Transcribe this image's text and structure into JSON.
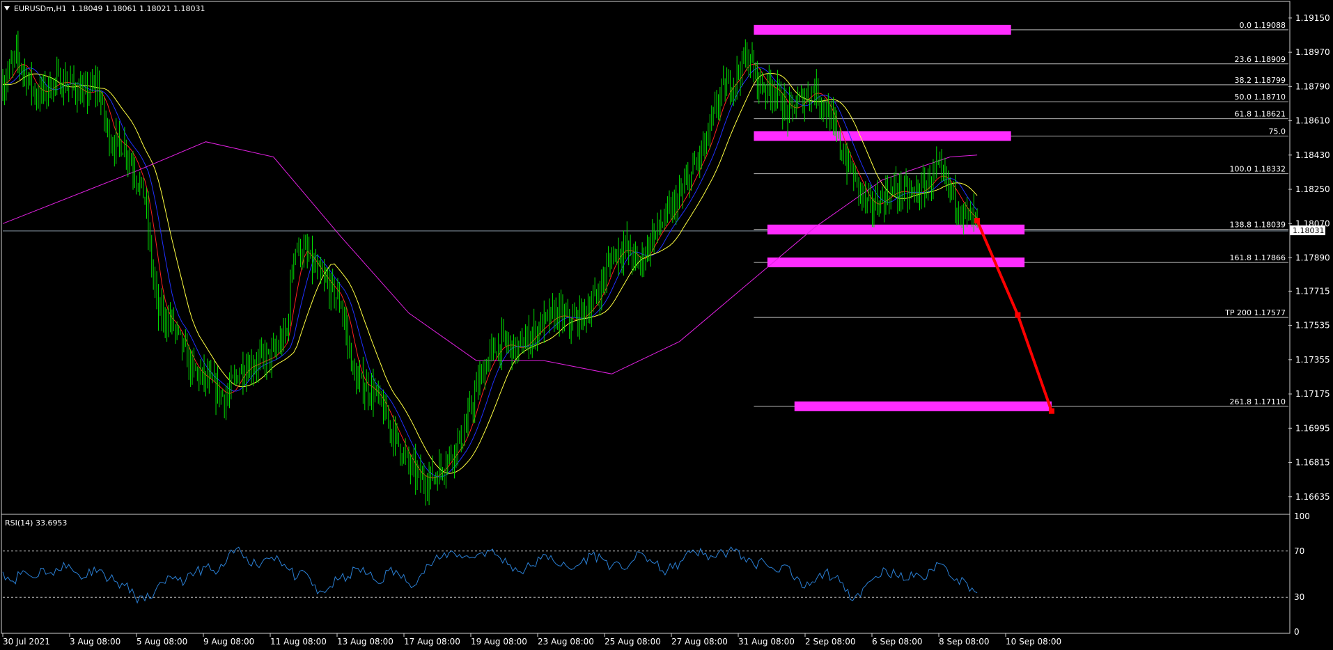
{
  "header": {
    "symbol": "EURUSDm,H1",
    "ohlc": "1.18049 1.18061 1.18021 1.18031"
  },
  "current_price_label": "1.18031",
  "rsi_header": "RSI(14) 33.6953",
  "colors": {
    "background": "#000000",
    "candle": "#00e000",
    "ma_fast_red": "#ff2020",
    "ma_blue": "#2030ff",
    "ma_yellow": "#ffff40",
    "ma_slow_magenta": "#e020e0",
    "zone": "#ff2cff",
    "arrow": "#ff0000",
    "rsi_line": "#2a7fd4"
  },
  "chart_data": [
    {
      "type": "line",
      "subtype": "candlestick price chart with fibonacci levels",
      "title": "EURUSDm,H1",
      "price_axis_ticks": [
        "1.19150",
        "1.18970",
        "1.18790",
        "1.18610",
        "1.18430",
        "1.18250",
        "1.18070",
        "1.17890",
        "1.17715",
        "1.17535",
        "1.17355",
        "1.17175",
        "1.16995",
        "1.16815",
        "1.16635"
      ],
      "ylim": [
        1.1655,
        1.1923
      ],
      "x_ticks": [
        "30 Jul 2021",
        "3 Aug 08:00",
        "5 Aug 08:00",
        "9 Aug 08:00",
        "11 Aug 08:00",
        "13 Aug 08:00",
        "17 Aug 08:00",
        "19 Aug 08:00",
        "23 Aug 08:00",
        "25 Aug 08:00",
        "27 Aug 08:00",
        "31 Aug 08:00",
        "2 Sep 08:00",
        "6 Sep 08:00",
        "8 Sep 08:00",
        "10 Sep 08:00"
      ],
      "price_path": [
        [
          0,
          1.188
        ],
        [
          2,
          1.1895
        ],
        [
          5,
          1.1874
        ],
        [
          8,
          1.1882
        ],
        [
          10,
          1.188
        ],
        [
          12,
          1.1874
        ],
        [
          14,
          1.188
        ],
        [
          15,
          1.1862
        ],
        [
          16,
          1.185
        ],
        [
          18,
          1.1848
        ],
        [
          20,
          1.183
        ],
        [
          21,
          1.182
        ],
        [
          22,
          1.1785
        ],
        [
          23,
          1.176
        ],
        [
          25,
          1.1755
        ],
        [
          28,
          1.173
        ],
        [
          30,
          1.1725
        ],
        [
          33,
          1.1715
        ],
        [
          35,
          1.173
        ],
        [
          38,
          1.1735
        ],
        [
          40,
          1.1738
        ],
        [
          42,
          1.175
        ],
        [
          43,
          1.1795
        ],
        [
          45,
          1.179
        ],
        [
          47,
          1.1778
        ],
        [
          48,
          1.1775
        ],
        [
          50,
          1.1765
        ],
        [
          52,
          1.1725
        ],
        [
          55,
          1.1718
        ],
        [
          58,
          1.1695
        ],
        [
          60,
          1.168
        ],
        [
          62,
          1.1672
        ],
        [
          64,
          1.1675
        ],
        [
          66,
          1.1685
        ],
        [
          68,
          1.1695
        ],
        [
          70,
          1.172
        ],
        [
          72,
          1.1738
        ],
        [
          74,
          1.1745
        ],
        [
          76,
          1.174
        ],
        [
          78,
          1.1748
        ],
        [
          80,
          1.1755
        ],
        [
          82,
          1.176
        ],
        [
          84,
          1.1755
        ],
        [
          86,
          1.176
        ],
        [
          88,
          1.177
        ],
        [
          89,
          1.178
        ],
        [
          90,
          1.179
        ],
        [
          92,
          1.1795
        ],
        [
          94,
          1.1785
        ],
        [
          96,
          1.18
        ],
        [
          98,
          1.181
        ],
        [
          100,
          1.182
        ],
        [
          102,
          1.1835
        ],
        [
          104,
          1.185
        ],
        [
          106,
          1.1875
        ],
        [
          108,
          1.1882
        ],
        [
          110,
          1.1895
        ],
        [
          112,
          1.188
        ],
        [
          114,
          1.1878
        ],
        [
          116,
          1.1865
        ],
        [
          118,
          1.1872
        ],
        [
          120,
          1.1878
        ],
        [
          122,
          1.1865
        ],
        [
          124,
          1.1845
        ],
        [
          126,
          1.183
        ],
        [
          128,
          1.1815
        ],
        [
          130,
          1.182
        ],
        [
          132,
          1.1825
        ],
        [
          134,
          1.1822
        ],
        [
          136,
          1.1825
        ],
        [
          138,
          1.1835
        ],
        [
          140,
          1.1825
        ],
        [
          142,
          1.1812
        ],
        [
          144,
          1.1808
        ]
      ],
      "moving_averages": [
        {
          "color": "ma_slow_magenta",
          "path": [
            [
              0,
              1.1807
            ],
            [
              20,
              1.1835
            ],
            [
              30,
              1.185
            ],
            [
              40,
              1.1842
            ],
            [
              50,
              1.18
            ],
            [
              60,
              1.176
            ],
            [
              70,
              1.1735
            ],
            [
              80,
              1.1735
            ],
            [
              90,
              1.1728
            ],
            [
              100,
              1.1745
            ],
            [
              110,
              1.1775
            ],
            [
              120,
              1.1805
            ],
            [
              130,
              1.183
            ],
            [
              140,
              1.1842
            ],
            [
              144,
              1.1843
            ]
          ]
        }
      ],
      "fibonacci_levels": [
        {
          "label": "0.0 1.19088",
          "price": 1.19088
        },
        {
          "label": "23.6 1.18909",
          "price": 1.18909
        },
        {
          "label": "38.2 1.18799",
          "price": 1.18799
        },
        {
          "label": "50.0 1.18710",
          "price": 1.1871
        },
        {
          "label": "61.8 1.18621",
          "price": 1.18621
        },
        {
          "label": "75.0",
          "price": 1.1853
        },
        {
          "label": "100.0 1.18332",
          "price": 1.18332
        },
        {
          "label": "138.8 1.18039",
          "price": 1.18039
        },
        {
          "label": "161.8 1.17866",
          "price": 1.17866
        },
        {
          "label": "TP 200 1.17577",
          "price": 1.17577
        },
        {
          "label": "261.8 1.17110",
          "price": 1.1711
        }
      ],
      "zones": [
        {
          "price": 1.19088,
          "x_start": 111,
          "x_end": 149
        },
        {
          "price": 1.1853,
          "x_start": 111,
          "x_end": 149
        },
        {
          "price": 1.18039,
          "x_start": 113,
          "x_end": 151
        },
        {
          "price": 1.17866,
          "x_start": 113,
          "x_end": 151
        },
        {
          "price": 1.1711,
          "x_start": 117,
          "x_end": 155
        }
      ],
      "projection": [
        [
          144,
          1.18085
        ],
        [
          150,
          1.1759
        ],
        [
          155,
          1.17085
        ]
      ],
      "current_price": 1.18031
    },
    {
      "type": "line",
      "title": "RSI(14) 33.6953",
      "ylim": [
        0,
        100
      ],
      "y_ticks": [
        "100",
        "70",
        "30",
        "0"
      ],
      "levels": [
        70,
        30
      ],
      "values": [
        52,
        44,
        53,
        47,
        55,
        49,
        60,
        52,
        47,
        56,
        50,
        44,
        40,
        31,
        27,
        35,
        42,
        48,
        44,
        52,
        56,
        50,
        60,
        72,
        65,
        58,
        64,
        66,
        55,
        47,
        50,
        33,
        37,
        45,
        48,
        55,
        50,
        42,
        53,
        50,
        42,
        47,
        58,
        63,
        69,
        67,
        64,
        68,
        70,
        64,
        58,
        52,
        57,
        63,
        66,
        57,
        54,
        60,
        67,
        64,
        57,
        55,
        61,
        68,
        60,
        53,
        55,
        62,
        71,
        67,
        65,
        69,
        70,
        65,
        58,
        61,
        54,
        58,
        45,
        38,
        43,
        52,
        47,
        35,
        31,
        40,
        48,
        54,
        49,
        45,
        51,
        46,
        60,
        55,
        46,
        42,
        34
      ]
    }
  ]
}
